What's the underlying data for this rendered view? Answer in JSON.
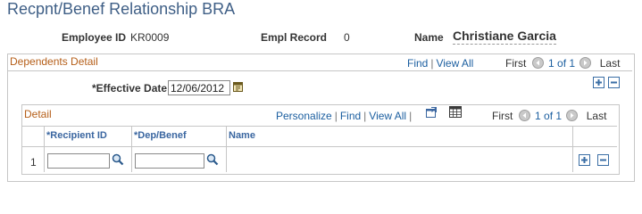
{
  "page": {
    "title": "Recpnt/Benef Relationship BRA"
  },
  "employee": {
    "id_label": "Employee ID",
    "id_value": "KR0009",
    "record_label": "Empl Record",
    "record_value": "0",
    "name_label": "Name",
    "name_value": "Christiane Garcia"
  },
  "dependents": {
    "title": "Dependents Detail",
    "find": "Find",
    "view_all": "View All",
    "first": "First",
    "range": "1 of 1",
    "last": "Last",
    "effective_date_label": "*Effective Date",
    "effective_date_value": "12/06/2012"
  },
  "detail": {
    "title": "Detail",
    "personalize": "Personalize",
    "find": "Find",
    "view_all": "View All",
    "first": "First",
    "range": "1 of 1",
    "last": "Last",
    "columns": [
      "*Recipient ID",
      "*Dep/Benef",
      "Name"
    ],
    "rows": [
      {
        "num": "1",
        "recipient_id": "",
        "dep_benef": "",
        "name": ""
      }
    ]
  },
  "colors": {
    "title": "#3f5f86",
    "section_header": "#b55e18",
    "link": "#1c5fa0",
    "border": "#c6c6c6"
  }
}
